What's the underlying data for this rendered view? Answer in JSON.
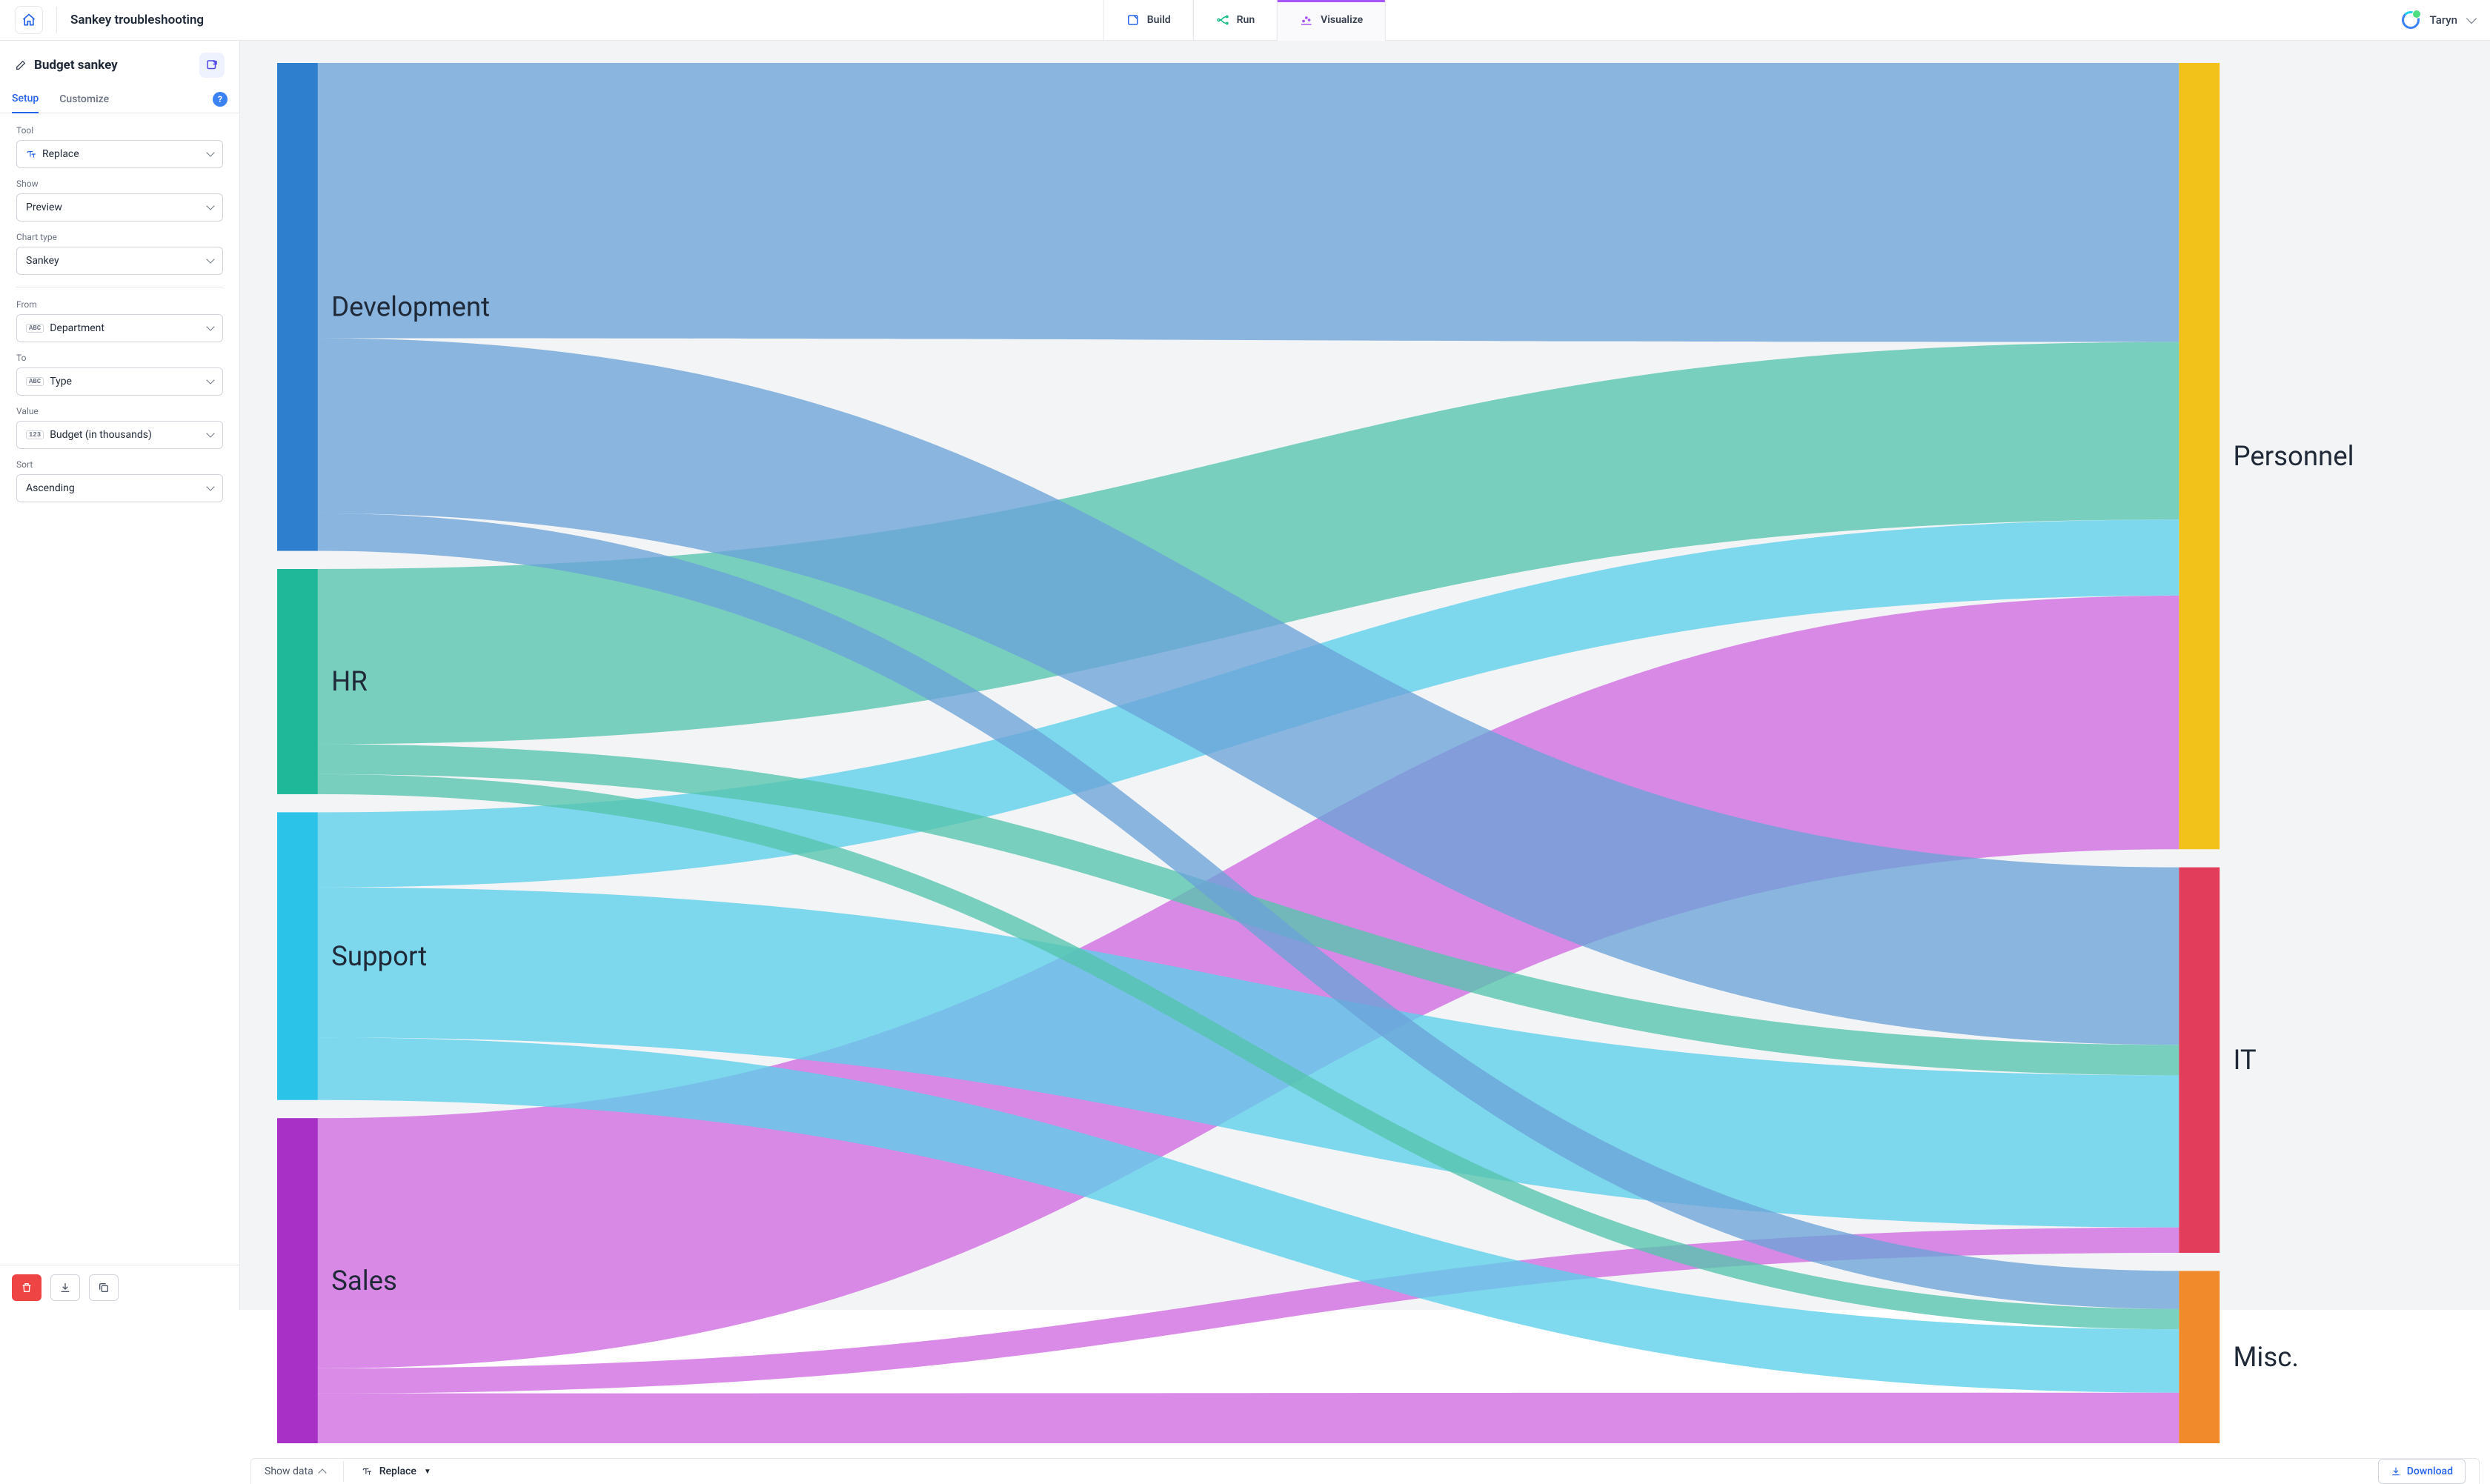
{
  "header": {
    "title": "Sankey troubleshooting",
    "tabs": [
      {
        "label": "Build",
        "icon": "build-icon",
        "color": "#2563eb"
      },
      {
        "label": "Run",
        "icon": "run-icon",
        "color": "#10b981"
      },
      {
        "label": "Visualize",
        "icon": "visualize-icon",
        "color": "#a855f7",
        "active": true
      }
    ],
    "user_name": "Taryn"
  },
  "sidebar": {
    "title": "Budget sankey",
    "tabs": {
      "setup": "Setup",
      "customize": "Customize"
    },
    "fields": {
      "tool_label": "Tool",
      "tool_value": "Replace",
      "show_label": "Show",
      "show_value": "Preview",
      "chart_type_label": "Chart type",
      "chart_type_value": "Sankey",
      "from_label": "From",
      "from_value": "Department",
      "from_type": "ABC",
      "to_label": "To",
      "to_value": "Type",
      "to_type": "ABC",
      "value_label": "Value",
      "value_value": "Budget (in thousands)",
      "value_type": "123",
      "sort_label": "Sort",
      "sort_value": "Ascending"
    }
  },
  "bottom": {
    "show_data": "Show data",
    "replace": "Replace",
    "download": "Download"
  },
  "chart_data": {
    "type": "sankey",
    "source_field": "Department",
    "target_field": "Type",
    "value_field": "Budget (in thousands)",
    "sources": [
      {
        "name": "Development",
        "color": "#2f7fcf"
      },
      {
        "name": "HR",
        "color": "#1fb99a"
      },
      {
        "name": "Support",
        "color": "#2cc3e8"
      },
      {
        "name": "Sales",
        "color": "#a930c7"
      }
    ],
    "targets": [
      {
        "name": "Personnel",
        "color": "#f2c11a"
      },
      {
        "name": "IT",
        "color": "#e23d5b"
      },
      {
        "name": "Misc.",
        "color": "#f08a2a"
      }
    ],
    "links": [
      {
        "source": "Development",
        "target": "Personnel",
        "value": 110,
        "color": "#6aa3d8"
      },
      {
        "source": "Development",
        "target": "IT",
        "value": 70,
        "color": "#6aa3d8"
      },
      {
        "source": "Development",
        "target": "Misc.",
        "value": 15,
        "color": "#6aa3d8"
      },
      {
        "source": "HR",
        "target": "Personnel",
        "value": 70,
        "color": "#55c4ad"
      },
      {
        "source": "HR",
        "target": "IT",
        "value": 12,
        "color": "#55c4ad"
      },
      {
        "source": "HR",
        "target": "Misc.",
        "value": 8,
        "color": "#55c4ad"
      },
      {
        "source": "Support",
        "target": "Personnel",
        "value": 30,
        "color": "#5cd0ea"
      },
      {
        "source": "Support",
        "target": "IT",
        "value": 60,
        "color": "#5cd0ea"
      },
      {
        "source": "Support",
        "target": "Misc.",
        "value": 25,
        "color": "#5cd0ea"
      },
      {
        "source": "Sales",
        "target": "Personnel",
        "value": 100,
        "color": "#d06ae0"
      },
      {
        "source": "Sales",
        "target": "IT",
        "value": 10,
        "color": "#d06ae0"
      },
      {
        "source": "Sales",
        "target": "Misc.",
        "value": 20,
        "color": "#d06ae0"
      }
    ]
  }
}
